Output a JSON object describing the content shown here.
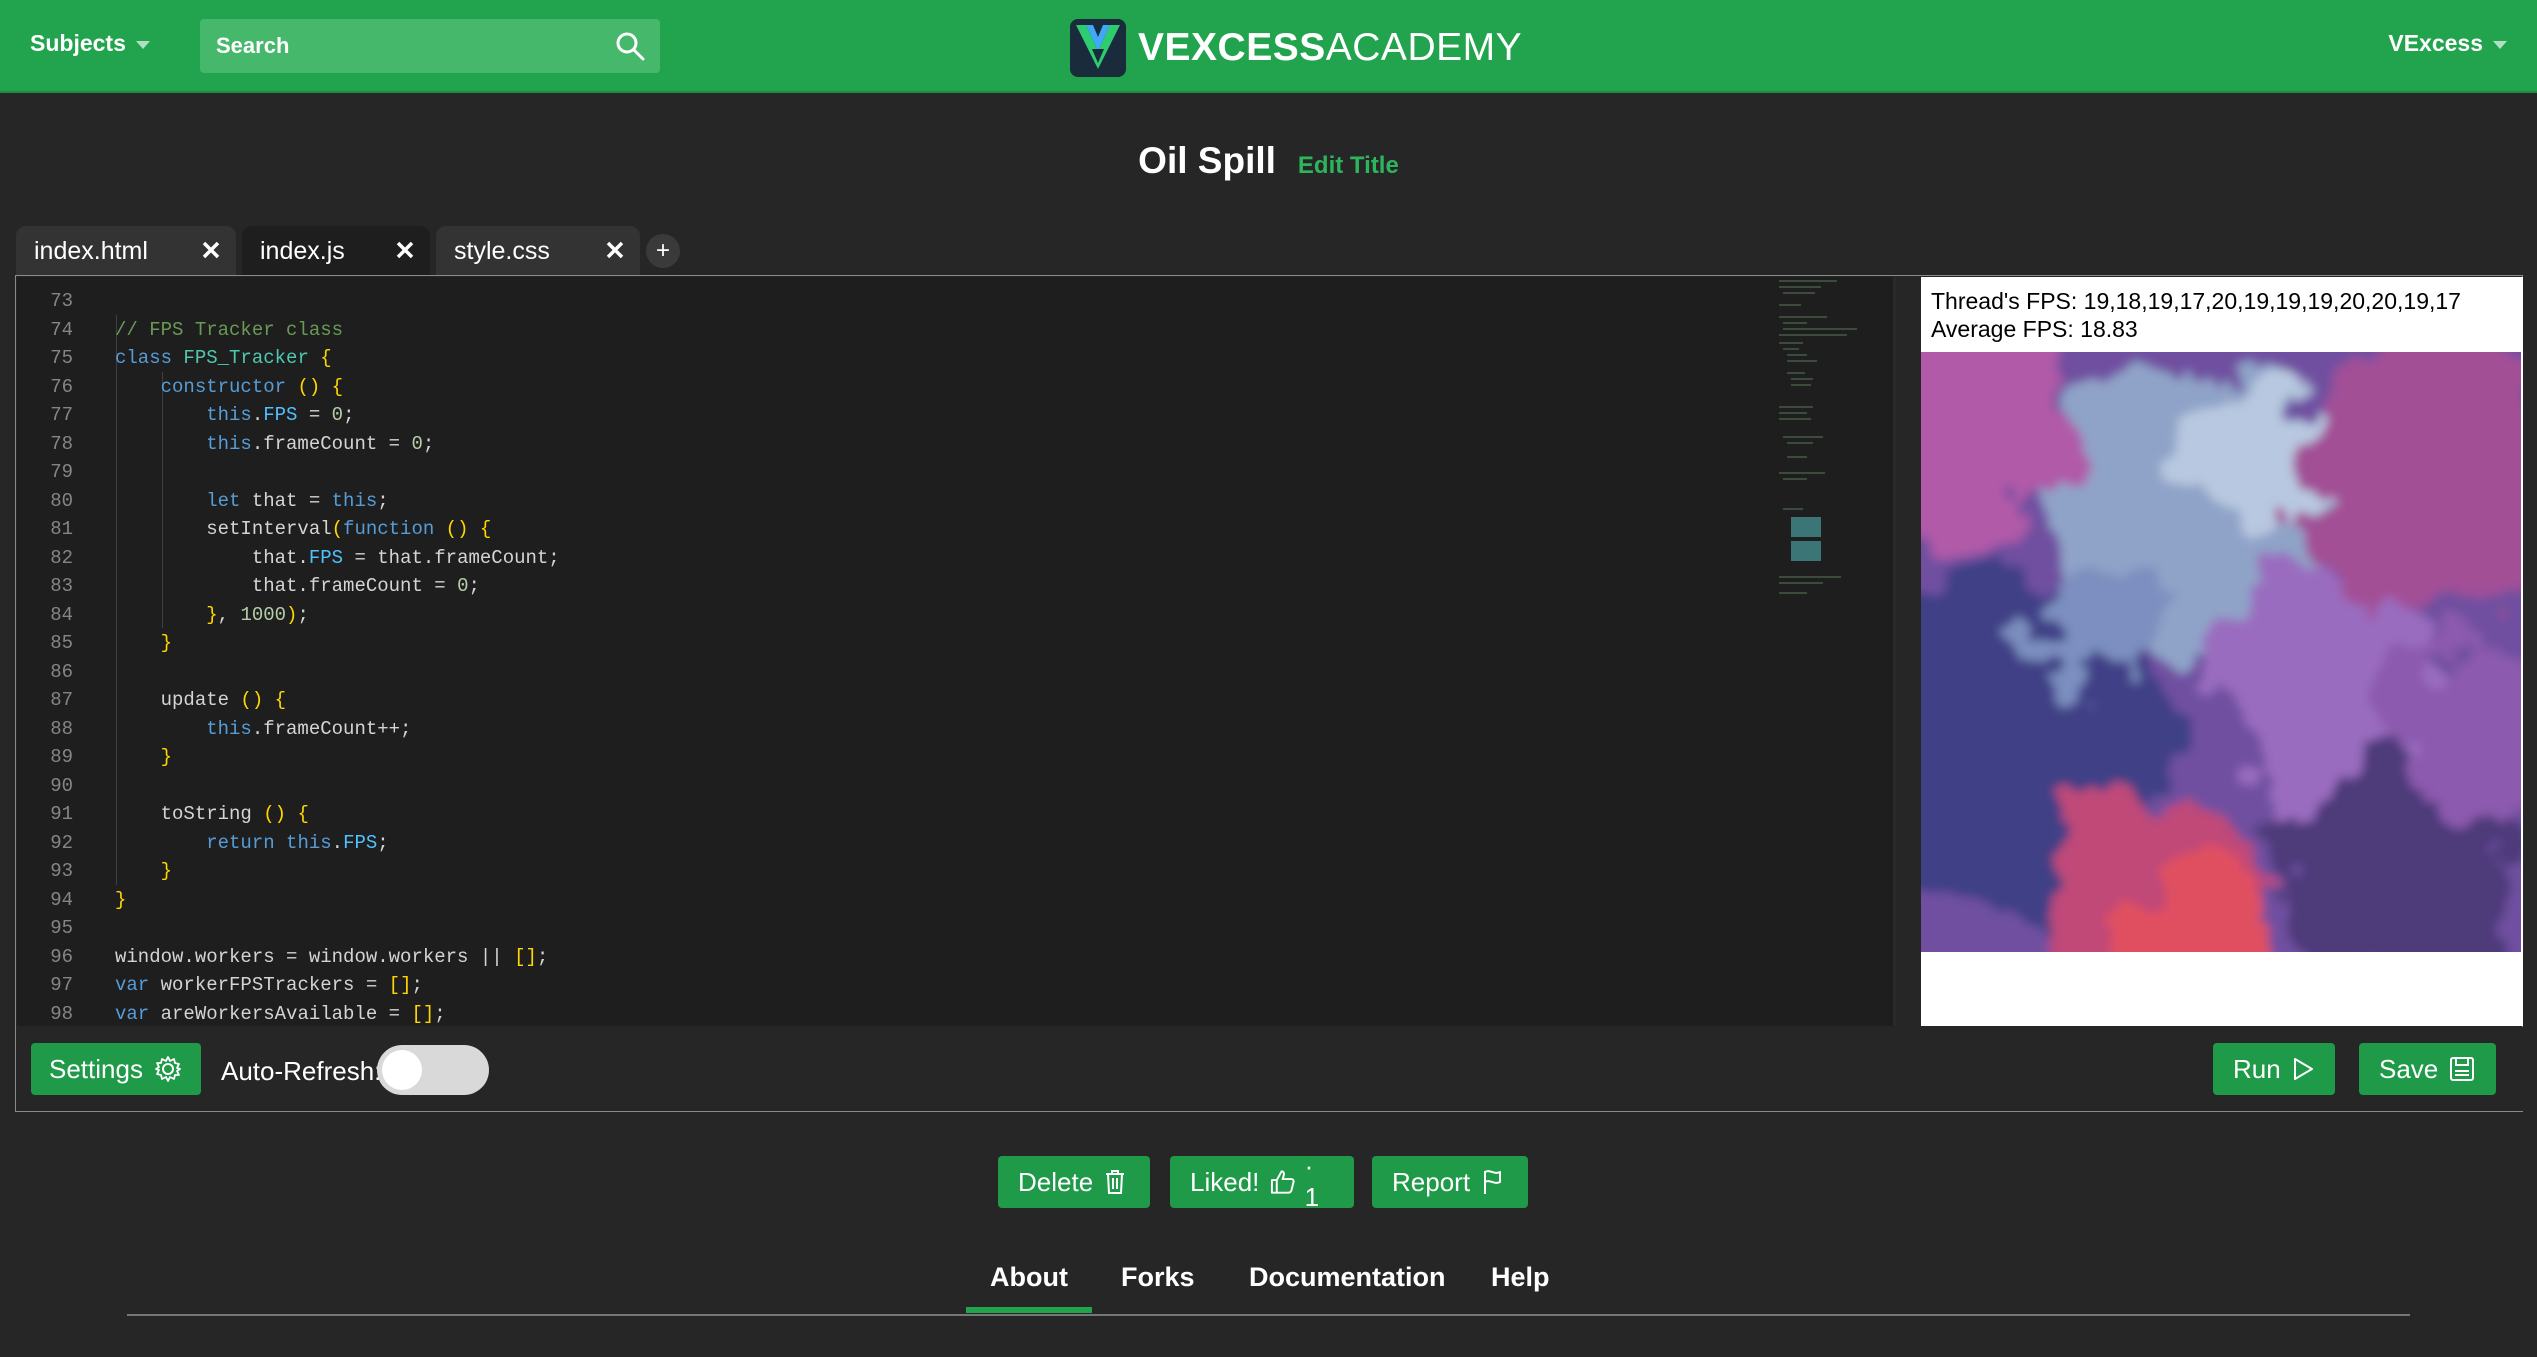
{
  "header": {
    "subjects_label": "Subjects",
    "search_placeholder": "Search",
    "logo_strong": "VEXCESS",
    "logo_light": "ACADEMY",
    "user_label": "VExcess"
  },
  "project": {
    "title": "Oil Spill",
    "edit_title_label": "Edit Title"
  },
  "tabs": [
    {
      "label": "index.html"
    },
    {
      "label": "index.js",
      "active": true
    },
    {
      "label": "style.css"
    }
  ],
  "add_tab_label": "+",
  "code": {
    "lines": [
      {
        "n": "73",
        "text": ""
      },
      {
        "n": "74",
        "text": "// FPS Tracker class"
      },
      {
        "n": "75",
        "text": "class FPS_Tracker {"
      },
      {
        "n": "76",
        "text": "    constructor () {"
      },
      {
        "n": "77",
        "text": "        this.FPS = 0;"
      },
      {
        "n": "78",
        "text": "        this.frameCount = 0;"
      },
      {
        "n": "79",
        "text": ""
      },
      {
        "n": "80",
        "text": "        let that = this;"
      },
      {
        "n": "81",
        "text": "        setInterval(function () {"
      },
      {
        "n": "82",
        "text": "            that.FPS = that.frameCount;"
      },
      {
        "n": "83",
        "text": "            that.frameCount = 0;"
      },
      {
        "n": "84",
        "text": "        }, 1000);"
      },
      {
        "n": "85",
        "text": "    }"
      },
      {
        "n": "86",
        "text": ""
      },
      {
        "n": "87",
        "text": "    update () {"
      },
      {
        "n": "88",
        "text": "        this.frameCount++;"
      },
      {
        "n": "89",
        "text": "    }"
      },
      {
        "n": "90",
        "text": ""
      },
      {
        "n": "91",
        "text": "    toString () {"
      },
      {
        "n": "92",
        "text": "        return this.FPS;"
      },
      {
        "n": "93",
        "text": "    }"
      },
      {
        "n": "94",
        "text": "}"
      },
      {
        "n": "95",
        "text": ""
      },
      {
        "n": "96",
        "text": "window.workers = window.workers || [];"
      },
      {
        "n": "97",
        "text": "var workerFPSTrackers = [];"
      },
      {
        "n": "98",
        "text": "var areWorkersAvailable = [];"
      }
    ]
  },
  "preview": {
    "thread_fps": "Thread's FPS: 19,18,19,17,20,19,19,19,20,20,19,17",
    "average_fps": "Average FPS: 18.83"
  },
  "toolbar": {
    "settings_label": "Settings",
    "auto_refresh_label": "Auto-Refresh:",
    "auto_refresh_on": false,
    "run_label": "Run",
    "save_label": "Save"
  },
  "actions": {
    "delete_label": "Delete",
    "liked_label": "Liked!",
    "liked_count": "· 1",
    "report_label": "Report"
  },
  "bottom_tabs": [
    {
      "label": "About",
      "active": true
    },
    {
      "label": "Forks"
    },
    {
      "label": "Documentation"
    },
    {
      "label": "Help"
    }
  ],
  "colors": {
    "brand_green": "#22a44f",
    "button_green": "#1e9a48",
    "background": "#262626",
    "editor_bg": "#1e1e1e"
  }
}
